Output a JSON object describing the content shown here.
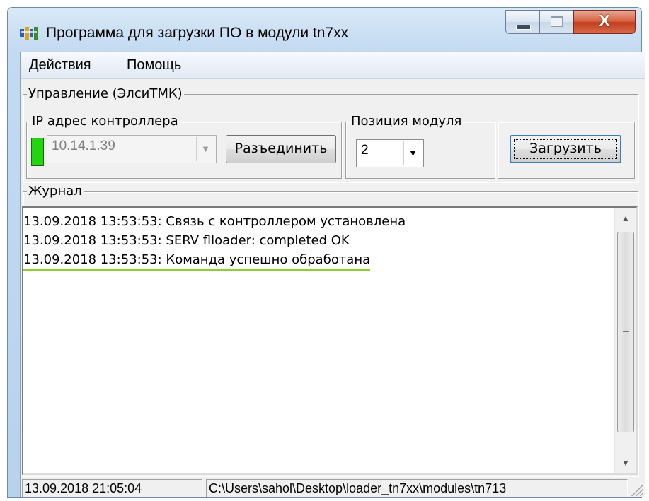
{
  "window": {
    "title": "Программа для загрузки ПО в модули tn7xx",
    "icon": "app-icon",
    "controls": {
      "minimize": "minimize-icon",
      "maximize": "maximize-icon",
      "close": "X"
    }
  },
  "menu": {
    "items": [
      "Действия",
      "Помощь"
    ]
  },
  "control_group": {
    "label": "Управление (ЭлсиТМК)",
    "ip_group": {
      "label": "IP адрес контроллера",
      "status_color": "#22d60f",
      "ip_value": "10.14.1.39",
      "disconnect_label": "Разъединить"
    },
    "position_group": {
      "label": "Позиция модуля",
      "value": "2"
    },
    "load_label": "Загрузить"
  },
  "journal": {
    "label": "Журнал",
    "lines": [
      "13.09.2018 13:53:53: Связь с контроллером установлена",
      "13.09.2018 13:53:53: SERV flloader: completed OK",
      "13.09.2018 13:53:53: Команда успешно обработана"
    ]
  },
  "statusbar": {
    "datetime": "13.09.2018 21:05:04",
    "path": "C:\\Users\\sahol\\Desktop\\loader_tn7xx\\modules\\tn713"
  }
}
